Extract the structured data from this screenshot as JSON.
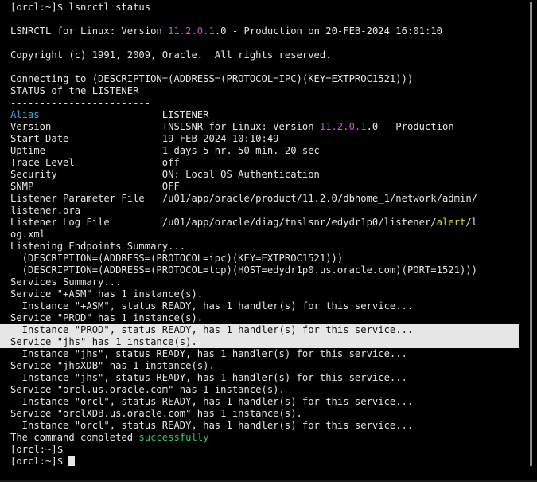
{
  "terminal": {
    "lines": [
      "[orcl:~]$ lsnrctl status",
      "",
      "LSNRCTL for Linux: Version 11.2.0.1.0 - Production on 20-FEB-2024 16:01:10",
      "",
      "Copyright (c) 1991, 2009, Oracle.  All rights reserved.",
      "",
      "Connecting to (DESCRIPTION=(ADDRESS=(PROTOCOL=IPC)(KEY=EXTPROC1521)))",
      "STATUS of the LISTENER",
      "------------------------",
      "Alias                     LISTENER",
      "Version                   TNSLSNR for Linux: Version 11.2.0.1.0 - Production",
      "Start Date                19-FEB-2024 10:10:49",
      "Uptime                    1 days 5 hr. 50 min. 20 sec",
      "Trace Level               off",
      "Security                  ON: Local OS Authentication",
      "SNMP                      OFF",
      "Listener Parameter File   /u01/app/oracle/product/11.2.0/dbhome_1/network/admin/",
      "listener.ora",
      "Listener Log File         /u01/app/oracle/diag/tnslsnr/edydr1p0/listener/alert/l",
      "og.xml",
      "Listening Endpoints Summary...",
      "  (DESCRIPTION=(ADDRESS=(PROTOCOL=ipc)(KEY=EXTPROC1521)))",
      "  (DESCRIPTION=(ADDRESS=(PROTOCOL=tcp)(HOST=edydr1p0.us.oracle.com)(PORT=1521)))",
      "Services Summary...",
      "Service \"+ASM\" has 1 instance(s).",
      "  Instance \"+ASM\", status READY, has 1 handler(s) for this service...",
      "Service \"PROD\" has 1 instance(s).",
      "  Instance \"PROD\", status READY, has 1 handler(s) for this service...",
      "Service \"jhs\" has 1 instance(s).",
      "  Instance \"jhs\", status READY, has 1 handler(s) for this service...",
      "Service \"jhsXDB\" has 1 instance(s).",
      "  Instance \"jhs\", status READY, has 1 handler(s) for this service...",
      "Service \"orcl.us.oracle.com\" has 1 instance(s).",
      "  Instance \"orcl\", status READY, has 1 handler(s) for this service...",
      "Service \"orclXDB.us.oracle.com\" has 1 instance(s).",
      "  Instance \"orcl\", status READY, has 1 handler(s) for this service...",
      "The command completed successfully",
      "[orcl:~]$",
      "[orcl:~]$ "
    ],
    "highlighted_lines": [
      27,
      28
    ],
    "colored_segments": [
      {
        "line": 2,
        "text": "11.2.0.1",
        "cls": "ver"
      },
      {
        "line": 9,
        "text": "Alias",
        "cls": "alias"
      },
      {
        "line": 10,
        "text": "11.2.0.1",
        "cls": "ver"
      },
      {
        "line": 18,
        "text": "alert",
        "cls": "alert"
      },
      {
        "line": 36,
        "text": "successfully",
        "cls": "ok"
      }
    ],
    "colors": {
      "background": "#000000",
      "foreground": "#e5e5e5",
      "alias": "#41a9d6",
      "version": "#d24cd6",
      "alert": "#d6d642",
      "success": "#34c759",
      "highlight": "#e6e6e6"
    }
  }
}
